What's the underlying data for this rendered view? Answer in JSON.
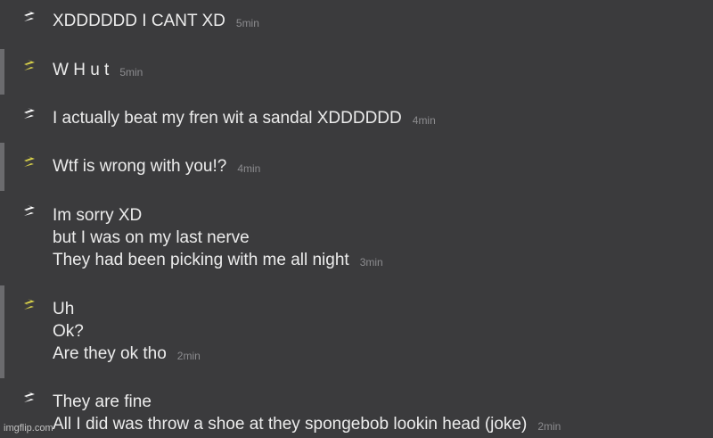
{
  "colors": {
    "background": "#3b3b3d",
    "text": "#ececec",
    "timestamp": "#8c8c8f",
    "icon_self": "#ffffff",
    "icon_other": "#d9d24a",
    "other_bar": "#6b6b6e"
  },
  "messages": [
    {
      "sender": "self",
      "icon": "lightning-icon",
      "lines": [
        "XDDDDDD I CANT XD"
      ],
      "time": "5min"
    },
    {
      "sender": "other",
      "icon": "lightning-icon",
      "lines": [
        "W H u t"
      ],
      "time": "5min"
    },
    {
      "sender": "self",
      "icon": "lightning-icon",
      "lines": [
        "I actually beat my fren wit a sandal XDDDDDD"
      ],
      "time": "4min"
    },
    {
      "sender": "other",
      "icon": "lightning-icon",
      "lines": [
        "Wtf is wrong with you!?"
      ],
      "time": "4min"
    },
    {
      "sender": "self",
      "icon": "lightning-icon",
      "lines": [
        "Im sorry XD",
        "but I was on my last nerve",
        "They had been picking with me all night"
      ],
      "time": "3min"
    },
    {
      "sender": "other",
      "icon": "lightning-icon",
      "lines": [
        "Uh",
        "Ok?",
        "Are they ok tho"
      ],
      "time": "2min"
    },
    {
      "sender": "self",
      "icon": "lightning-icon",
      "lines": [
        "They are fine",
        "All I did was throw a shoe at they spongebob lookin head (joke)"
      ],
      "time": "2min"
    }
  ],
  "watermark": "imgflip.com"
}
